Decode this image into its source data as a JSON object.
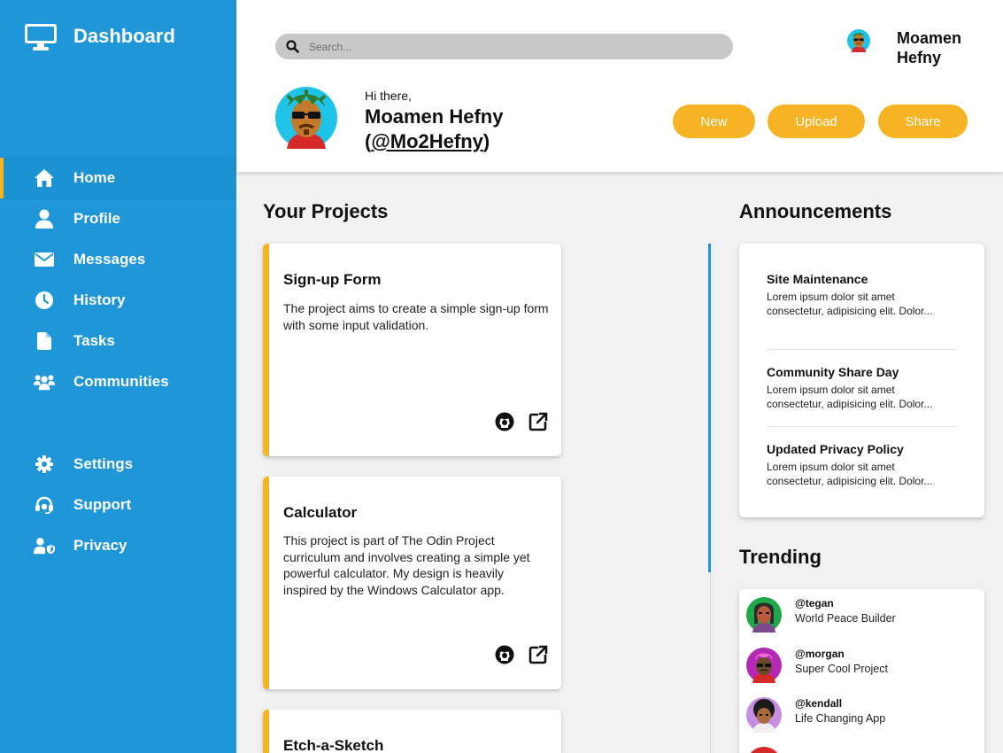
{
  "sidebar": {
    "brand_icon": "monitor-icon",
    "brand_title": "Dashboard",
    "main_items": [
      {
        "label": "Home",
        "icon": "home-icon",
        "active": true
      },
      {
        "label": "Profile",
        "icon": "user-icon"
      },
      {
        "label": "Messages",
        "icon": "envelope-icon"
      },
      {
        "label": "History",
        "icon": "clock-icon"
      },
      {
        "label": "Tasks",
        "icon": "file-icon"
      },
      {
        "label": "Communities",
        "icon": "users-icon"
      }
    ],
    "secondary_items": [
      {
        "label": "Settings",
        "icon": "gear-icon"
      },
      {
        "label": "Support",
        "icon": "headset-icon"
      },
      {
        "label": "Privacy",
        "icon": "user-shield-icon"
      }
    ]
  },
  "header": {
    "search_placeholder": "Search...",
    "user_name": "Moamen Hefny",
    "greeting": "Hi there,",
    "full_name": "Moamen Hefny",
    "handle_prefix": "(",
    "handle": "@Mo2Hefny",
    "handle_suffix": ")",
    "buttons": {
      "new": "New",
      "upload": "Upload",
      "share": "Share"
    }
  },
  "projects": {
    "title": "Your Projects",
    "items": [
      {
        "title": "Sign-up Form",
        "description": "The project aims to create a simple sign-up form with some input validation."
      },
      {
        "title": "Calculator",
        "description": "This project is part of The Odin Project curriculum and involves creating a simple yet powerful calculator. My design is heavily inspired by the Windows Calculator app."
      },
      {
        "title": "Etch-a-Sketch",
        "description": ""
      }
    ]
  },
  "announcements": {
    "title": "Announcements",
    "items": [
      {
        "title": "Site Maintenance",
        "text_line1": "Lorem ipsum dolor sit amet",
        "text_line2": "consectetur, adipisicing elit. Dolor..."
      },
      {
        "title": "Community Share Day",
        "text_line1": "Lorem ipsum dolor sit amet",
        "text_line2": "consectetur, adipisicing elit. Dolor..."
      },
      {
        "title": "Updated Privacy Policy",
        "text_line1": "Lorem ipsum dolor sit amet",
        "text_line2": "consectetur, adipisicing elit. Dolor..."
      }
    ]
  },
  "trending": {
    "title": "Trending",
    "items": [
      {
        "handle": "@tegan",
        "project": "World Peace Builder"
      },
      {
        "handle": "@morgan",
        "project": "Super Cool Project"
      },
      {
        "handle": "@kendall",
        "project": "Life Changing App"
      }
    ]
  },
  "colors": {
    "sidebar": "#1e96d8",
    "accent": "#f6b323",
    "background": "#f1f1f1"
  }
}
